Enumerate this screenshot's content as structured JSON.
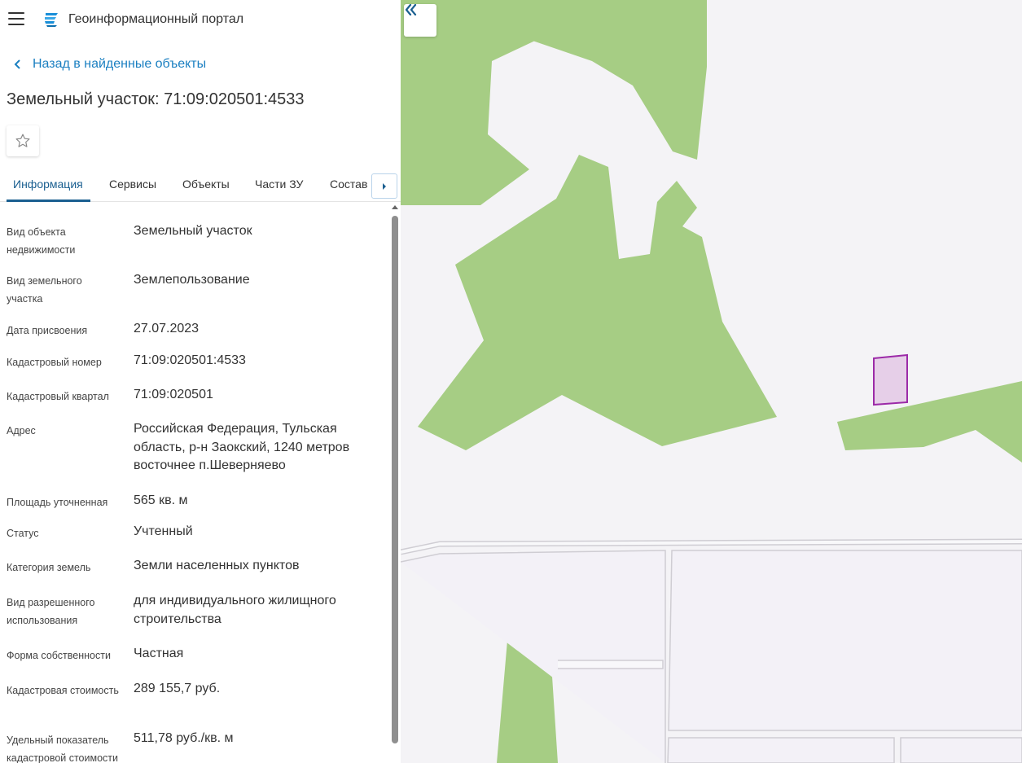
{
  "header": {
    "portal_title": "Геоинформационный портал"
  },
  "back_link": "Назад в найденные объекты",
  "object_title": "Земельный участок: 71:09:020501:4533",
  "tabs": [
    {
      "label": "Информация"
    },
    {
      "label": "Сервисы"
    },
    {
      "label": "Объекты"
    },
    {
      "label": "Части ЗУ"
    },
    {
      "label": "Состав"
    }
  ],
  "properties": [
    {
      "label": "Вид объекта недвижимости",
      "value": "Земельный участок"
    },
    {
      "label": "Вид земельного участка",
      "value": "Землепользование"
    },
    {
      "label": "Дата присвоения",
      "value": "27.07.2023"
    },
    {
      "label": "Кадастровый номер",
      "value": "71:09:020501:4533"
    },
    {
      "label": "Кадастровый квартал",
      "value": "71:09:020501"
    },
    {
      "label": "Адрес",
      "value": "Российская Федерация, Тульская область, р-н Заокский, 1240 метров восточнее п.Шеверняево"
    },
    {
      "label": "Площадь уточненная",
      "value": "565 кв. м"
    },
    {
      "label": "Статус",
      "value": "Учтенный"
    },
    {
      "label": "Категория земель",
      "value": "Земли населенных пунктов"
    },
    {
      "label": "Вид разрешенного использования",
      "value": "для индивидуального жилищного строительства"
    },
    {
      "label": "Форма собственности",
      "value": "Частная"
    },
    {
      "label": "Кадастровая стоимость",
      "value": "289 155,7 руб."
    },
    {
      "label": "Удельный показатель кадастровой стоимости",
      "value": "511,78 руб./кв. м"
    }
  ],
  "colors": {
    "accent": "#1a7fc1",
    "active_tab": "#1a5f90",
    "forest": "#a6cd84",
    "map_background": "#f4f3f6",
    "parcel_fill": "#e6cfe8",
    "parcel_stroke": "#9c2aa8"
  },
  "icons": {
    "menu": "hamburger-icon",
    "logo": "portal-logo-icon",
    "back": "chevron-left-icon",
    "favorite": "star-outline-icon",
    "tabs_next": "chevron-right-icon",
    "collapse": "double-chevron-left-icon"
  }
}
